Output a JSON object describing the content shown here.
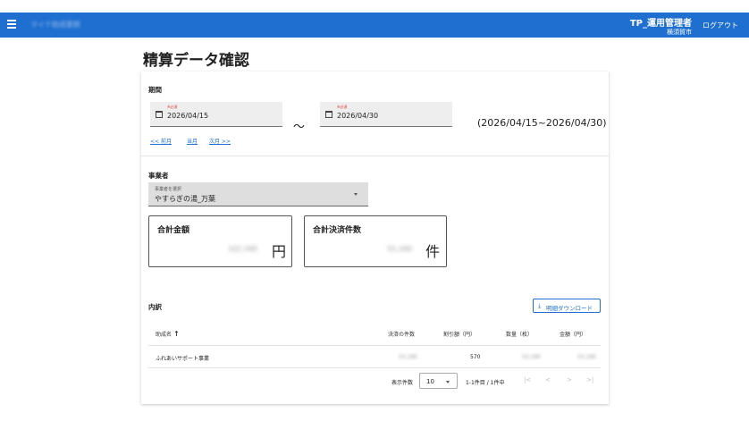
{
  "header": {
    "app_title": "マイナ助成業務",
    "user_name": "TP_運用管理者",
    "user_org": "横須賀市",
    "logout_label": "ログアウト"
  },
  "page": {
    "title": "精算データ確認"
  },
  "period": {
    "label": "期間",
    "start": {
      "required_label": "※必須",
      "value": "2026/04/15"
    },
    "separator": "〜",
    "end": {
      "required_label": "※必須",
      "value": "2026/04/30"
    },
    "range_text": "(2026/04/15~2026/04/30)",
    "links": {
      "prev": "<< 前月",
      "current": "当月",
      "next": "次月 >>"
    }
  },
  "business": {
    "label": "事業者",
    "select_label": "事業者を選択",
    "select_value": "やすらぎの湯_万葉"
  },
  "totals": {
    "amount": {
      "title": "合計金額",
      "value": "102,340",
      "unit": "円"
    },
    "count": {
      "title": "合計決済件数",
      "value": "55,180",
      "unit": "件"
    }
  },
  "breakdown": {
    "label": "内訳",
    "download_label": "明細ダウンロード",
    "columns": [
      "助成名",
      "決済の件数",
      "割引額（円）",
      "数量（枚）",
      "金額（円）"
    ],
    "sort_icon": "↑",
    "rows": [
      {
        "name": "ふれあいサポート事業",
        "count": "55,180",
        "discount": "570",
        "quantity": "55,180",
        "amount": "55,180"
      }
    ],
    "pagination": {
      "rows_per_page_label": "表示件数",
      "rows_per_page": "10",
      "info": "1-1件目 / 1件中",
      "first": "|<",
      "prev": "<",
      "next": ">",
      "last": ">|"
    }
  },
  "colors": {
    "primary": "#1e6fd0",
    "required": "#e04040"
  }
}
